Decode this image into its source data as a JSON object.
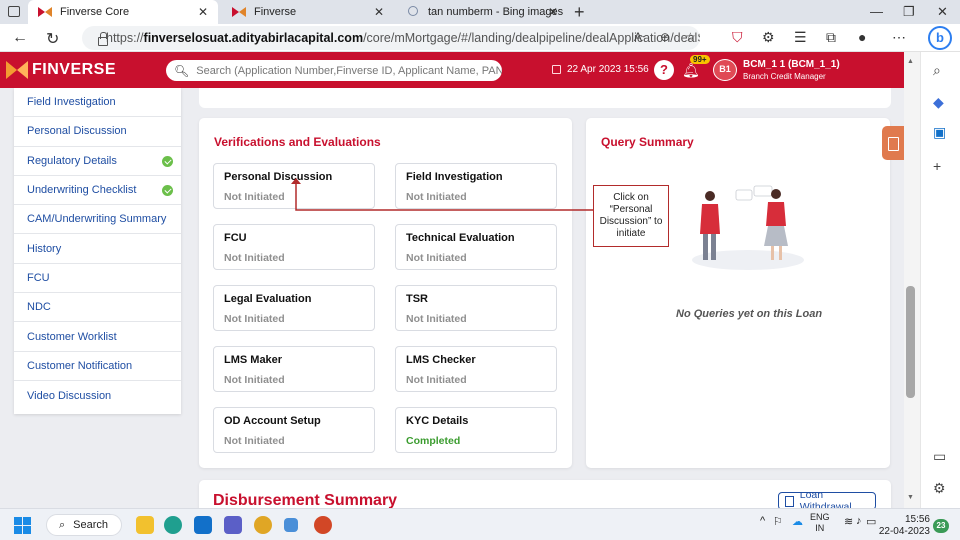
{
  "browser": {
    "tabs": [
      {
        "label": "Finverse Core",
        "active": true
      },
      {
        "label": "Finverse",
        "active": false
      },
      {
        "label": "tan numberm - Bing images",
        "active": false
      }
    ],
    "url_prefix": "https://",
    "url_domain": "finverselosuat.adityabirlacapital.com",
    "url_path": "/core/mMortgage/#/landing/dealpipeline/dealApplication/dealSu..."
  },
  "header": {
    "brand": "FINVERSE",
    "search_placeholder": "Search (Application Number,Finverse ID, Applicant Name, PAN Number)",
    "date": "22 Apr 2023 15:56",
    "notification_count": "99+",
    "avatar_initials": "B1",
    "user_name": "BCM_1 1 (BCM_1_1)",
    "user_role": "Branch Credit Manager",
    "brand_color": "#c8102e"
  },
  "sidebar": {
    "items": [
      {
        "label": "Field Investigation",
        "checked": false
      },
      {
        "label": "Personal Discussion",
        "checked": false
      },
      {
        "label": "Regulatory Details",
        "checked": true
      },
      {
        "label": "Underwriting Checklist",
        "checked": true
      },
      {
        "label": "CAM/Underwriting Summary",
        "checked": false
      },
      {
        "label": "History",
        "checked": false
      },
      {
        "label": "FCU",
        "checked": false
      },
      {
        "label": "NDC",
        "checked": false
      },
      {
        "label": "Customer Worklist",
        "checked": false
      },
      {
        "label": "Customer Notification",
        "checked": false
      },
      {
        "label": "Video Discussion",
        "checked": false
      }
    ]
  },
  "verifications": {
    "title": "Verifications and Evaluations",
    "items": [
      {
        "name": "Personal Discussion",
        "status": "Not Initiated"
      },
      {
        "name": "Field Investigation",
        "status": "Not Initiated"
      },
      {
        "name": "FCU",
        "status": "Not Initiated"
      },
      {
        "name": "Technical Evaluation",
        "status": "Not Initiated"
      },
      {
        "name": "Legal Evaluation",
        "status": "Not Initiated"
      },
      {
        "name": "TSR",
        "status": "Not Initiated"
      },
      {
        "name": "LMS Maker",
        "status": "Not Initiated"
      },
      {
        "name": "LMS Checker",
        "status": "Not Initiated"
      },
      {
        "name": "OD Account Setup",
        "status": "Not Initiated"
      },
      {
        "name": "KYC Details",
        "status": "Completed"
      }
    ]
  },
  "query_summary": {
    "title": "Query Summary",
    "empty_text": "No Queries yet on this Loan"
  },
  "callout": {
    "text": "Click on “Personal Discussion” to initiate"
  },
  "disbursement": {
    "title": "Disbursement Summary",
    "loan_withdrawal_label": "Loan Withdrawal"
  },
  "taskbar": {
    "search_label": "Search",
    "lang_primary": "ENG",
    "lang_secondary": "IN",
    "time": "15:56",
    "date": "22-04-2023",
    "notification_count": "23"
  }
}
